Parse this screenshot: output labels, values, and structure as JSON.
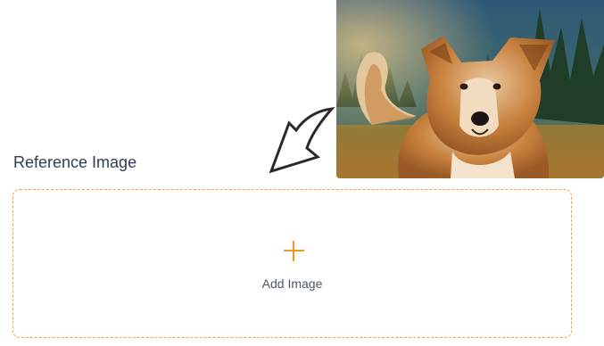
{
  "reference_section": {
    "title": "Reference Image"
  },
  "photo": {
    "subject": "dog-photo",
    "colors": {
      "sky": "#2f5876",
      "trees": "#1d3a24",
      "grass": "#8f6a2c",
      "fur": "#c57a3a",
      "fur_light": "#f1dcc0"
    }
  },
  "upload": {
    "icon": "plus-icon",
    "label": "Add Image",
    "accent_color": "#f5961e",
    "border_color": "#f2a33a"
  },
  "arrow": {
    "icon": "curved-arrow-icon"
  }
}
